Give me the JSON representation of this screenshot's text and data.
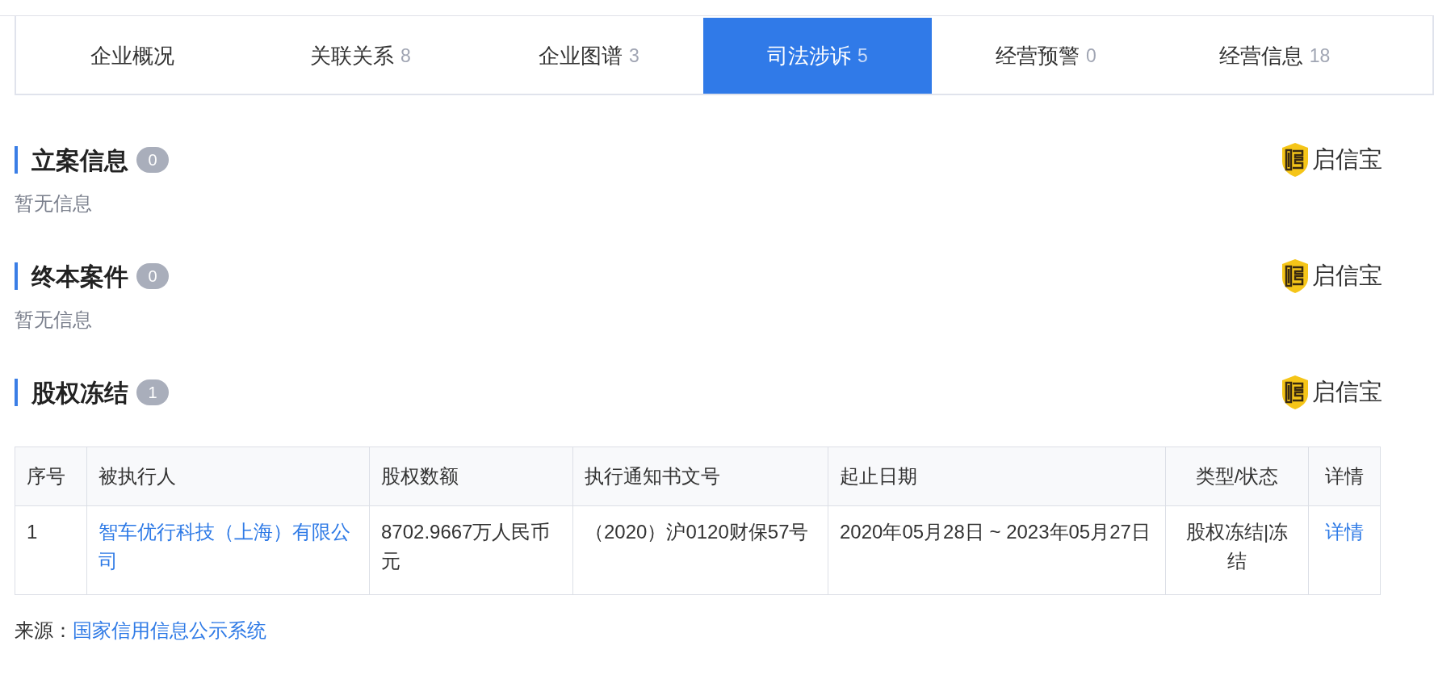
{
  "tabs": [
    {
      "label": "企业概况",
      "selected": false
    },
    {
      "label": "关联关系",
      "count": "8",
      "selected": false
    },
    {
      "label": "企业图谱",
      "count": "3",
      "selected": false
    },
    {
      "label": "司法涉诉",
      "count": "5",
      "selected": true
    },
    {
      "label": "经营预警",
      "count": "0",
      "selected": false
    },
    {
      "label": "经营信息",
      "count": "18",
      "selected": false
    }
  ],
  "sections": [
    {
      "title": "立案信息",
      "count": "0",
      "brand": "启信宝",
      "empty_text": "暂无信息"
    },
    {
      "title": "终本案件",
      "count": "0",
      "brand": "启信宝",
      "empty_text": "暂无信息"
    },
    {
      "title": "股权冻结",
      "count": "1",
      "brand": "启信宝",
      "table": {
        "columns": [
          "序号",
          "被执行人",
          "股权数额",
          "执行通知书文号",
          "起止日期",
          "类型/状态",
          "详情"
        ],
        "rows": [
          [
            {
              "text": "1",
              "kind": "plain"
            },
            {
              "text": "智车优行科技（上海）有限公司",
              "kind": "link"
            },
            {
              "text": "8702.9667万人民币元",
              "kind": "plain"
            },
            {
              "text": "（2020）沪0120财保57号",
              "kind": "plain"
            },
            {
              "text": "2020年05月28日 ~ 2023年05月27日",
              "kind": "plain"
            },
            {
              "text": "股权冻结|冻结",
              "kind": "plain"
            },
            {
              "text": "详情",
              "kind": "link"
            }
          ]
        ]
      }
    }
  ],
  "source": {
    "label": "来源：",
    "link": "国家信用信息公示系统"
  }
}
